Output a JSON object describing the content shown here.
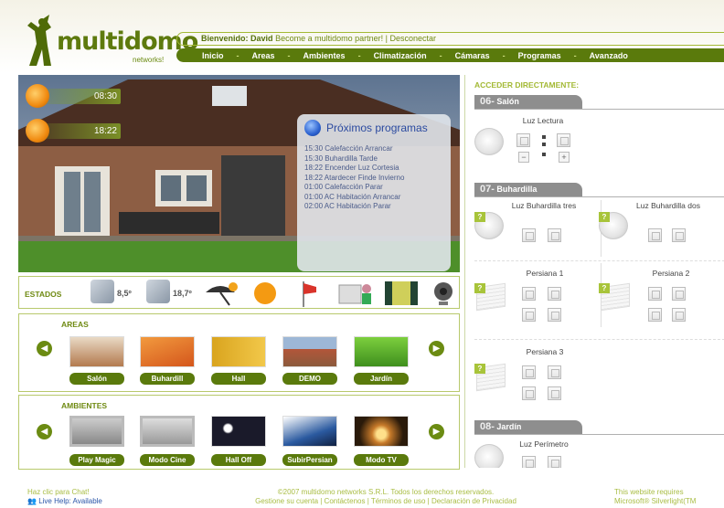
{
  "header": {
    "logo_text": "multidomo",
    "logo_sub": "networks!",
    "welcome_prefix": "Bienvenido:",
    "user": "David",
    "welcome_rest": "Become a multidomo partner! | Desconectar",
    "menu": [
      "Inicio",
      "Areas",
      "Ambientes",
      "Climatización",
      "Cámaras",
      "Programas",
      "Avanzado"
    ]
  },
  "hero": {
    "clock1": "08:30",
    "clock2": "18:22",
    "programs_title": "Próximos programas",
    "programs": [
      "15:30 Calefacción Arrancar",
      "15:30 Buhardilla Tarde",
      "18:22 Encender Luz Cortesia",
      "18:22 Atardecer Finde Invierno",
      "01:00 Calefacción Parar",
      "01:00 AC Habitación Arrancar",
      "02:00 AC Habitación Parar"
    ]
  },
  "estados": {
    "label": "ESTADOS",
    "temp1": "8,5º",
    "temp2": "18,7º"
  },
  "areas": {
    "title": "AREAS",
    "items": [
      "Salón",
      "Buhardill",
      "Hall",
      "DEMO",
      "Jardín"
    ]
  },
  "ambientes": {
    "title": "AMBIENTES",
    "items": [
      "Play Magic",
      "Modo Cine",
      "Hall Off",
      "SubirPersian",
      "Modo TV"
    ]
  },
  "right": {
    "header": "ACCEDER DIRECTAMENTE:",
    "rooms": [
      {
        "num": "06-",
        "name": "Salón"
      },
      {
        "num": "07-",
        "name": "Buhardilla"
      },
      {
        "num": "08-",
        "name": "Jardín"
      }
    ],
    "devices": {
      "luz_lectura": "Luz Lectura",
      "luz_buh_tres": "Luz Buhardilla tres",
      "luz_buh_dos": "Luz Buhardilla dos",
      "persiana1": "Persiana 1",
      "persiana2": "Persiana 2",
      "persiana3": "Persiana 3",
      "luz_perimetro": "Luz Perímetro"
    }
  },
  "footer": {
    "chat1": "Haz clic para Chat!",
    "chat2": "Live Help: Available",
    "copy1": "©2007 multidomo networks S.R.L. Todos los derechos reservados.",
    "copy2": "Gestione su cuenta | Contáctenos | Términos de uso | Declaración de Privacidad",
    "sl1": "This website requires",
    "sl2": "Microsoft® Silverlight(TM"
  },
  "colors": {
    "brand": "#5a7a0c",
    "accent": "#a3b934"
  }
}
